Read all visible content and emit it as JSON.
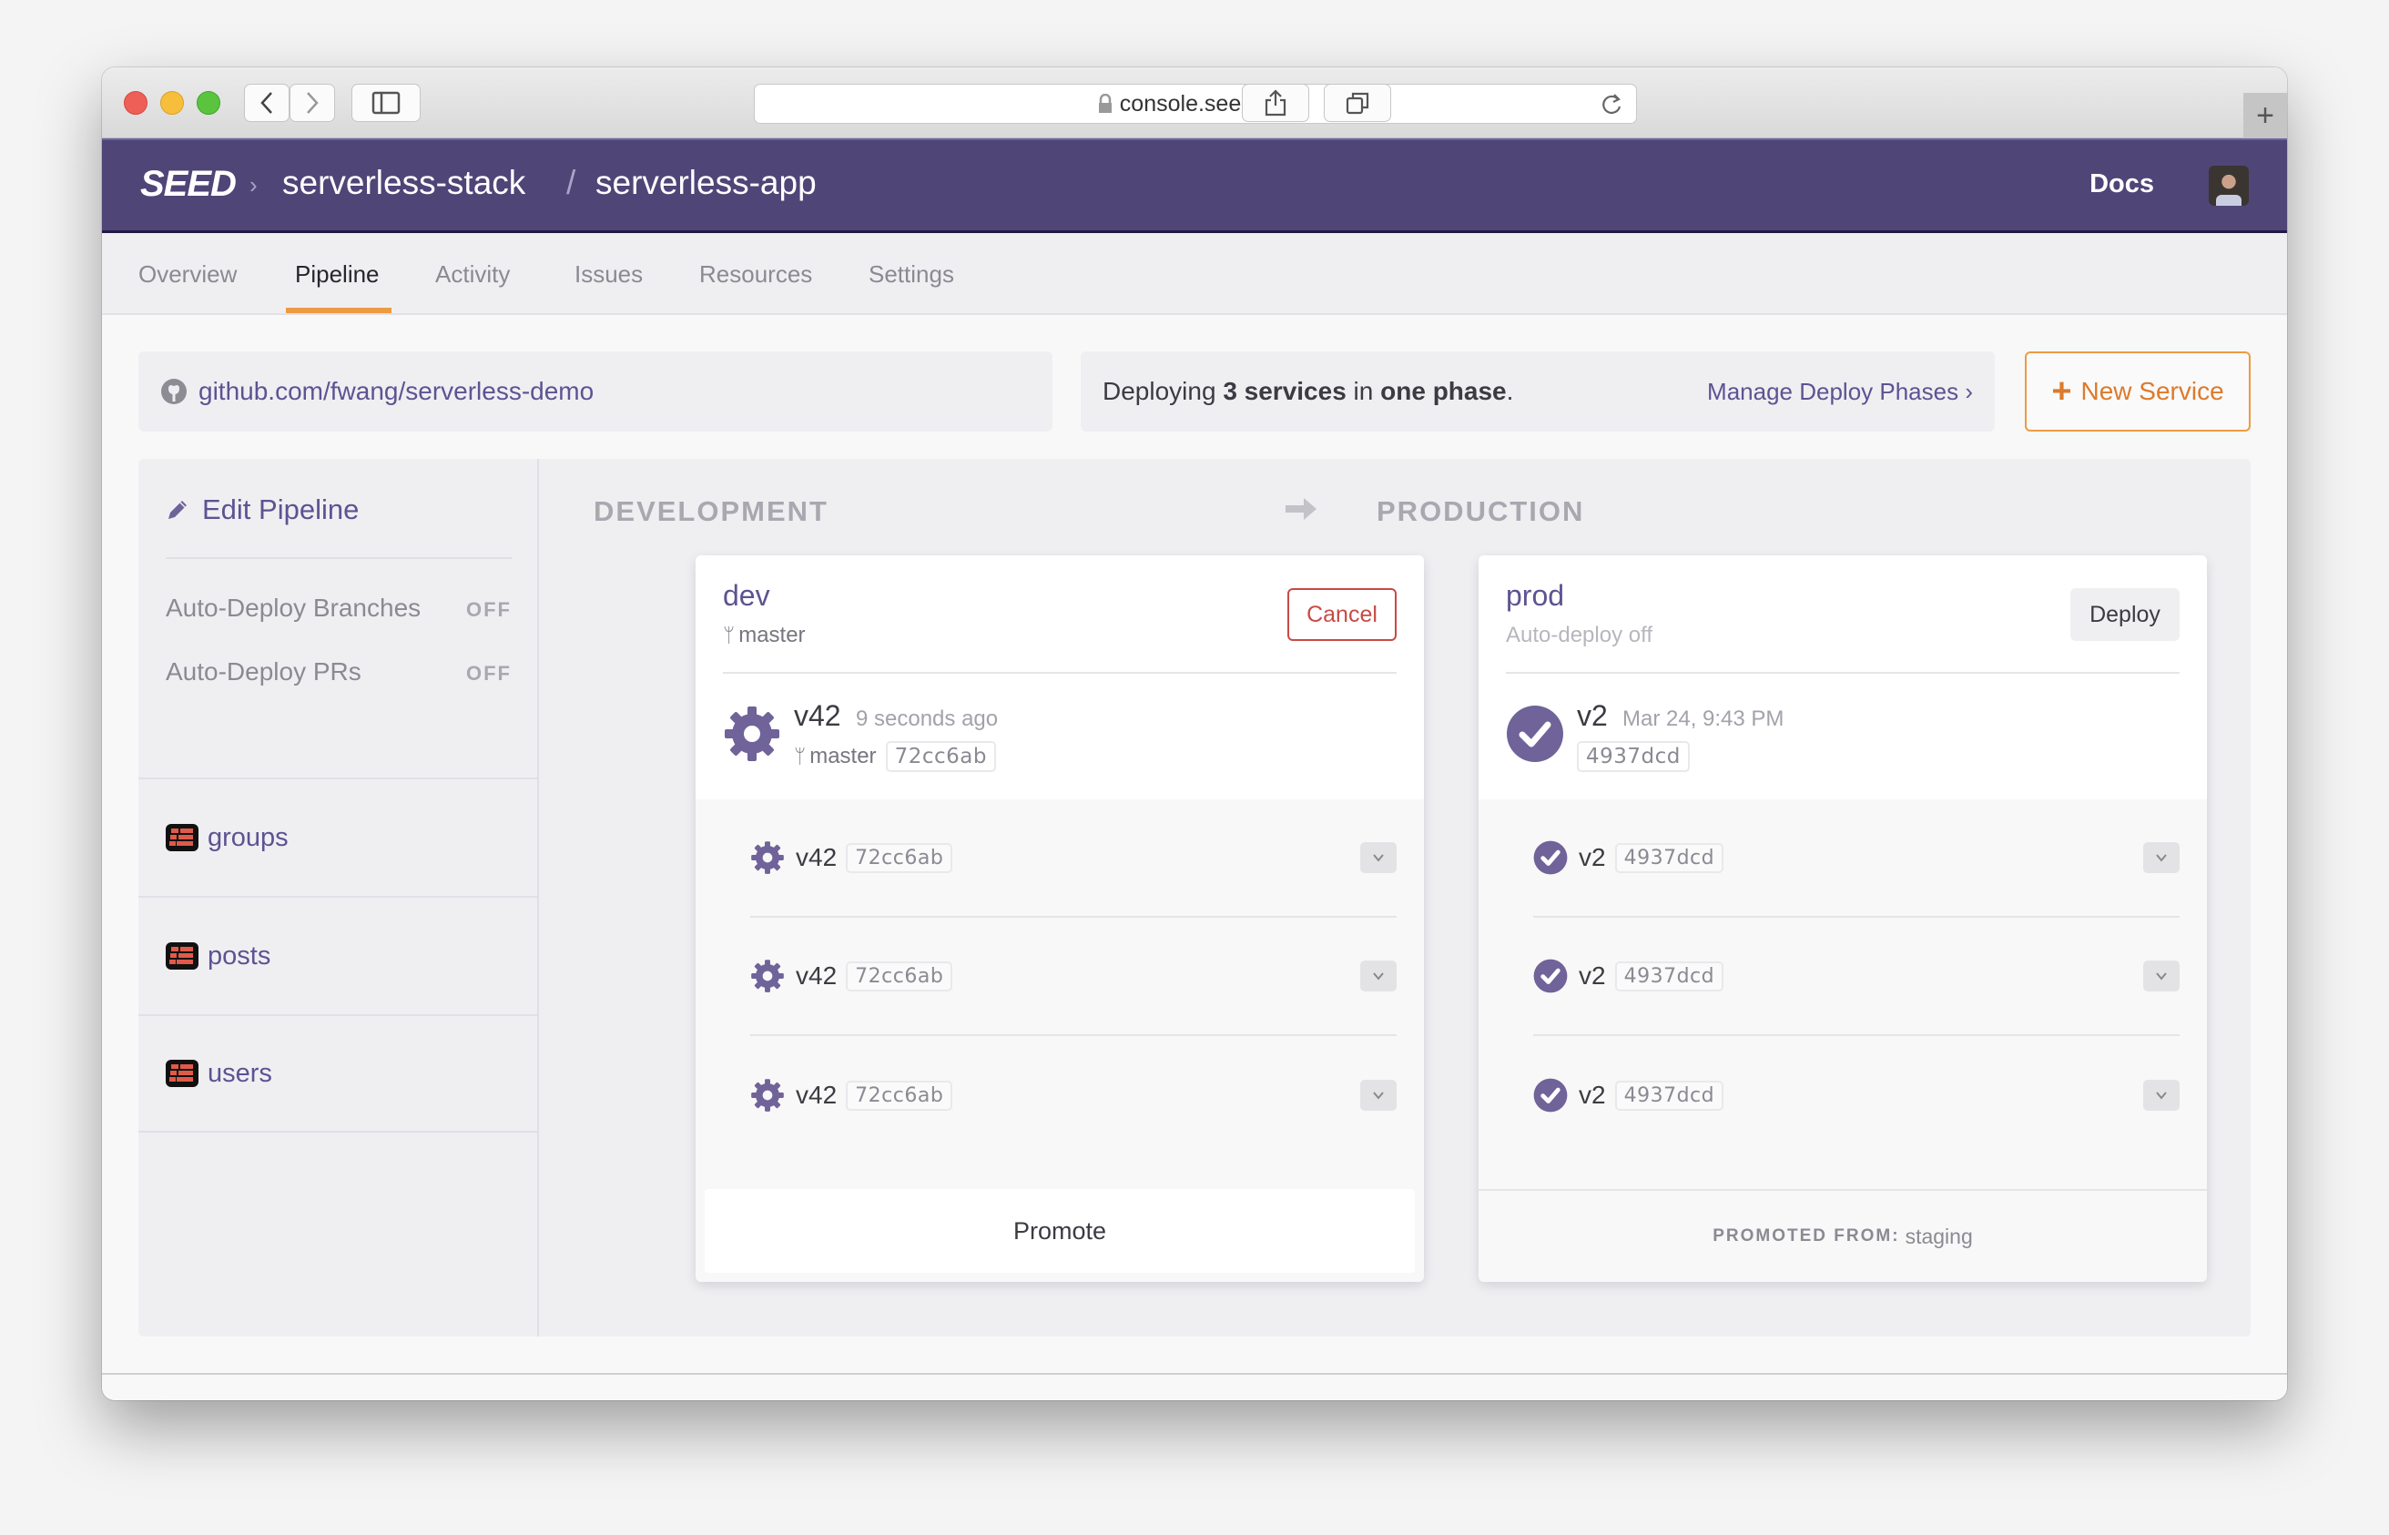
{
  "browser": {
    "url": "console.seed.run",
    "new_tab_label": "+"
  },
  "header": {
    "logo": "SEED",
    "org": "serverless-stack",
    "separator": "/",
    "app": "serverless-app",
    "docs_label": "Docs"
  },
  "tabs": [
    {
      "label": "Overview",
      "active": false
    },
    {
      "label": "Pipeline",
      "active": true
    },
    {
      "label": "Activity",
      "active": false
    },
    {
      "label": "Issues",
      "active": false
    },
    {
      "label": "Resources",
      "active": false
    },
    {
      "label": "Settings",
      "active": false
    }
  ],
  "info": {
    "repo": "github.com/fwang/serverless-demo",
    "deploy_prefix": "Deploying ",
    "deploy_count": "3 services",
    "deploy_mid": " in ",
    "deploy_phase": "one phase",
    "deploy_suffix": ".",
    "manage_link": "Manage Deploy Phases ›",
    "new_service_label": "New Service"
  },
  "sidebar": {
    "edit_label": "Edit Pipeline",
    "toggles": [
      {
        "label": "Auto-Deploy Branches",
        "value": "OFF"
      },
      {
        "label": "Auto-Deploy PRs",
        "value": "OFF"
      }
    ],
    "services": [
      {
        "name": "groups"
      },
      {
        "name": "posts"
      },
      {
        "name": "users"
      }
    ]
  },
  "stages": {
    "development": {
      "title": "DEVELOPMENT",
      "name": "dev",
      "branch": "master",
      "action_label": "Cancel",
      "build": {
        "version": "v42",
        "time": "9 seconds ago",
        "branch": "master",
        "sha": "72cc6ab",
        "status": "in-progress"
      },
      "services": [
        {
          "version": "v42",
          "sha": "72cc6ab",
          "status": "in-progress"
        },
        {
          "version": "v42",
          "sha": "72cc6ab",
          "status": "in-progress"
        },
        {
          "version": "v42",
          "sha": "72cc6ab",
          "status": "in-progress"
        }
      ],
      "footer_label": "Promote"
    },
    "production": {
      "title": "PRODUCTION",
      "name": "prod",
      "subtitle": "Auto-deploy off",
      "action_label": "Deploy",
      "build": {
        "version": "v2",
        "time": "Mar 24, 9:43 PM",
        "sha": "4937dcd",
        "status": "success"
      },
      "services": [
        {
          "version": "v2",
          "sha": "4937dcd",
          "status": "success"
        },
        {
          "version": "v2",
          "sha": "4937dcd",
          "status": "success"
        },
        {
          "version": "v2",
          "sha": "4937dcd",
          "status": "success"
        }
      ],
      "footer_label": "PROMOTED FROM:",
      "footer_value": "staging"
    }
  },
  "colors": {
    "brand": "#4f4577",
    "link": "#5d5392",
    "accent": "#ee9a44",
    "danger": "#c94a44",
    "status": "#6f6399"
  }
}
